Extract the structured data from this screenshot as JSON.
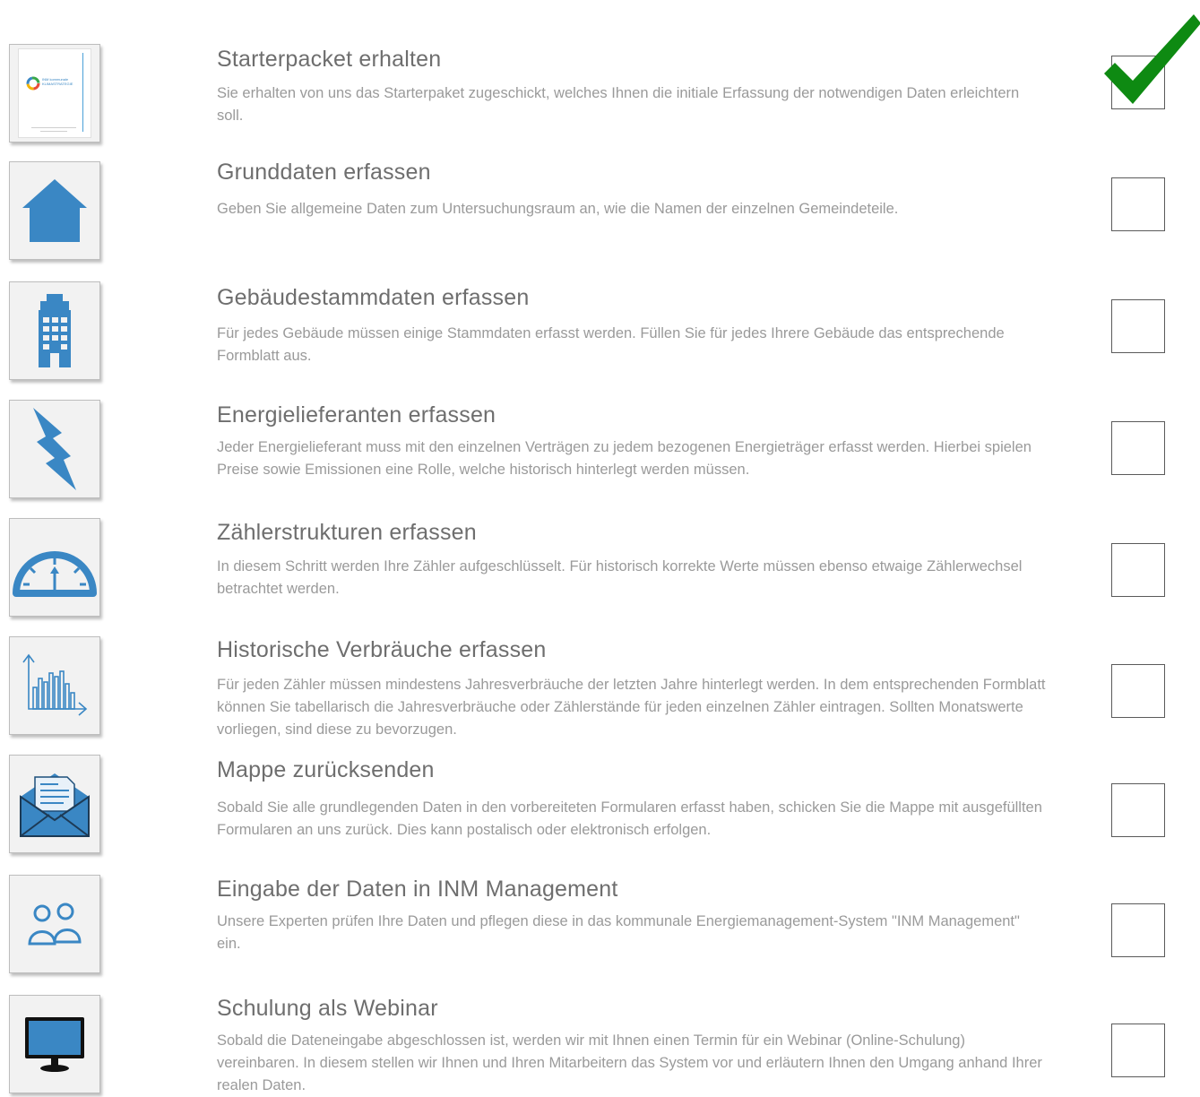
{
  "steps": [
    {
      "title": "Starterpacket erhalten",
      "description": "Sie erhalten von uns das Starterpaket zugeschickt, welches Ihnen die initiale Erfassung der notwendigen Daten erleichtern soll.",
      "icon": "brochure-icon",
      "checked": true,
      "brochure_title": "INM kommunale KLIMASTRATEGIE"
    },
    {
      "title": "Grunddaten erfassen",
      "description": "Geben Sie allgemeine Daten zum Untersuchungsraum an, wie die Namen der einzelnen Gemeindeteile.",
      "icon": "house-icon",
      "checked": false
    },
    {
      "title": "Gebäudestammdaten erfassen",
      "description": "Für jedes Gebäude müssen einige Stammdaten erfasst werden. Füllen Sie für jedes Ihrere Gebäude das entsprechende Formblatt aus.",
      "icon": "building-icon",
      "checked": false
    },
    {
      "title": "Energielieferanten erfassen",
      "description": "Jeder Energielieferant muss mit den einzelnen Verträgen zu jedem bezogenen Energieträger erfasst werden. Hierbei spielen Preise sowie Emissionen eine Rolle, welche historisch hinterlegt werden müssen.",
      "icon": "lightning-icon",
      "checked": false
    },
    {
      "title": "Zählerstrukturen erfassen",
      "description": "In diesem Schritt werden Ihre Zähler aufgeschlüsselt. Für historisch korrekte Werte müssen ebenso etwaige Zählerwechsel betrachtet werden.",
      "icon": "gauge-icon",
      "checked": false
    },
    {
      "title": "Historische Verbräuche erfassen",
      "description": "Für jeden Zähler müssen mindestens Jahresverbräuche der letzten Jahre hinterlegt werden. In dem entsprechenden Formblatt können Sie tabellarisch die Jahresverbräuche oder Zählerstände für jeden einzelnen Zähler eintragen. Sollten Monatswerte vorliegen, sind diese zu bevorzugen.",
      "icon": "bar-chart-icon",
      "checked": false
    },
    {
      "title": "Mappe zurücksenden",
      "description": "Sobald Sie alle grundlegenden Daten in den vorbereiteten Formularen erfasst haben, schicken Sie die Mappe mit ausgefüllten Formularen an uns zurück. Dies kann postalisch oder elektronisch erfolgen.",
      "icon": "envelope-icon",
      "checked": false
    },
    {
      "title": "Eingabe der Daten in INM Management",
      "description": "Unsere Experten prüfen Ihre Daten und pflegen diese in das kommunale Energiemanagement-System \"INM Management\" ein.",
      "icon": "users-icon",
      "checked": false
    },
    {
      "title": "Schulung als Webinar",
      "description": "Sobald die Dateneingabe abgeschlossen ist, werden wir mit Ihnen einen Termin für ein Webinar (Online-Schulung) vereinbaren. In diesem stellen wir Ihnen und Ihren Mitarbeitern das System vor und erläutern Ihnen den Umgang anhand Ihrer realen Daten.",
      "icon": "monitor-icon",
      "checked": false
    }
  ],
  "colors": {
    "icon_blue": "#3a87c4",
    "check_green": "#0e8a12"
  }
}
